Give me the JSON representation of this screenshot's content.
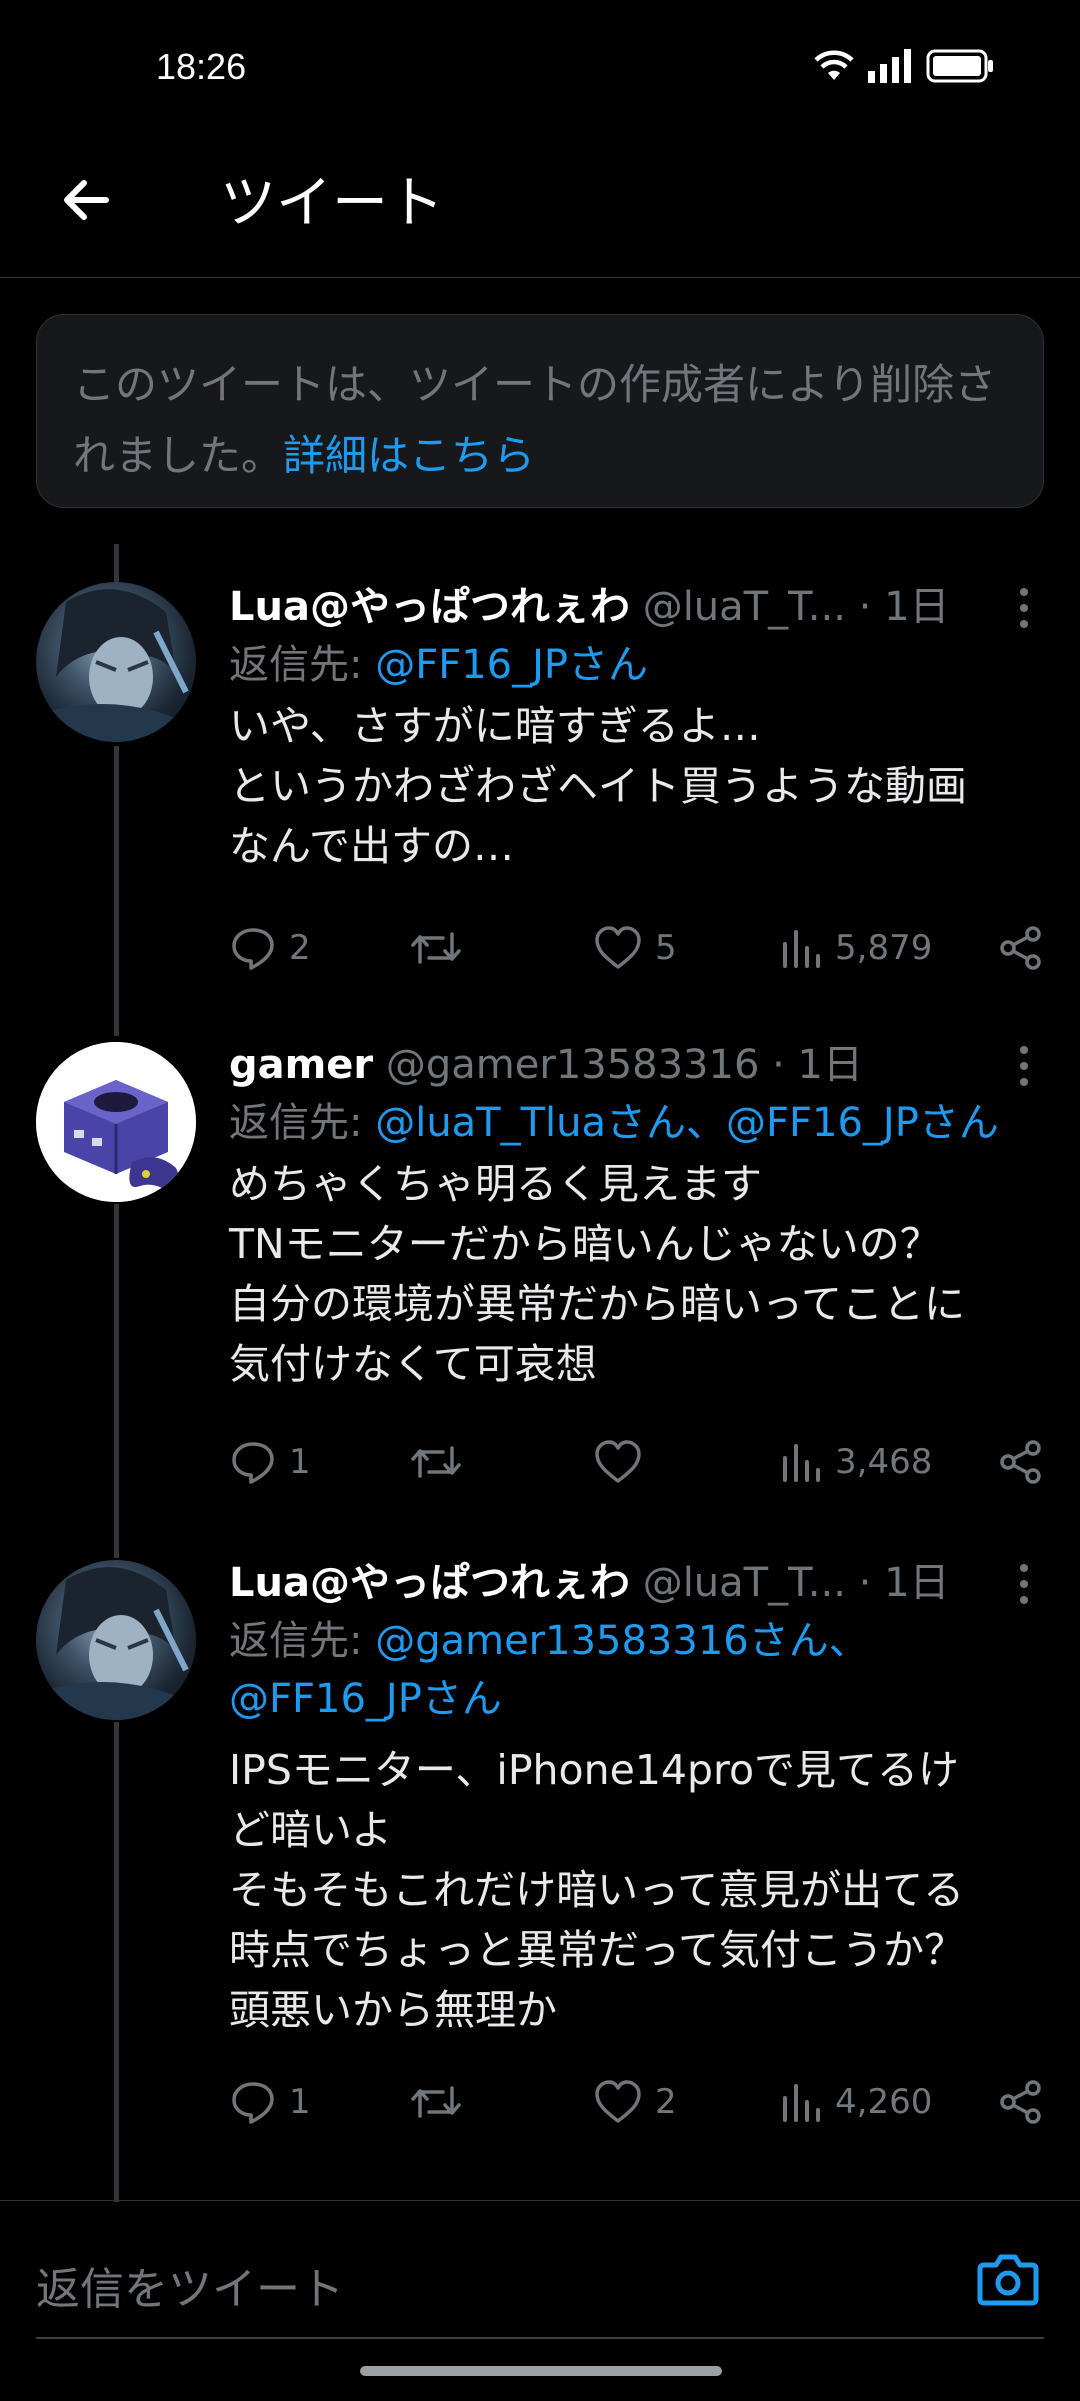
{
  "status": {
    "time": "18:26"
  },
  "header": {
    "title": "ツイート"
  },
  "deleted_notice": {
    "text": "このツイートは、ツイートの作成者により削除されました。",
    "link": "詳細はこちら"
  },
  "tweets": [
    {
      "name": "Lua@やっぱつれぇわ",
      "handle": "@luaT_T...",
      "time": "· 1日",
      "reply_label": "返信先:",
      "reply_to": "@FF16_JPさん",
      "text": "いや、さすがに暗すぎるよ…\nというかわざわざヘイト買うような動画\nなんで出すの…",
      "replies": "2",
      "retweets": "",
      "likes": "5",
      "views": "5,879"
    },
    {
      "name": "gamer",
      "handle": "@gamer13583316",
      "time": "· 1日",
      "reply_label": "返信先:",
      "reply_to": "@luaT_Tluaさん、@FF16_JPさん",
      "text": "めちゃくちゃ明るく見えます\nTNモニターだから暗いんじゃないの？\n自分の環境が異常だから暗いってことに\n気付けなくて可哀想",
      "replies": "1",
      "retweets": "",
      "likes": "",
      "views": "3,468"
    },
    {
      "name": "Lua@やっぱつれぇわ",
      "handle": "@luaT_T...",
      "time": "· 1日",
      "reply_label": "返信先:",
      "reply_to_line1": "@gamer13583316さん、",
      "reply_to_line2": "@FF16_JPさん",
      "text": "IPSモニター、iPhone14proで見てるけ\nど暗いよ\nそもそもこれだけ暗いって意見が出てる\n時点でちょっと異常だって気付こうか？\n頭悪いから無理か",
      "replies": "1",
      "retweets": "",
      "likes": "2",
      "views": "4,260"
    }
  ],
  "composer": {
    "placeholder": "返信をツイート"
  },
  "icons": {
    "back": "arrow-left-icon",
    "more": "more-vertical-icon",
    "reply": "reply-icon",
    "retweet": "retweet-icon",
    "like": "heart-icon",
    "views": "bar-chart-icon",
    "share": "share-icon",
    "camera": "camera-icon",
    "wifi": "wifi-icon",
    "signal": "signal-icon",
    "battery": "battery-icon"
  },
  "colors": {
    "accent": "#1d9bf0",
    "muted": "#71767b",
    "background": "#000000"
  }
}
